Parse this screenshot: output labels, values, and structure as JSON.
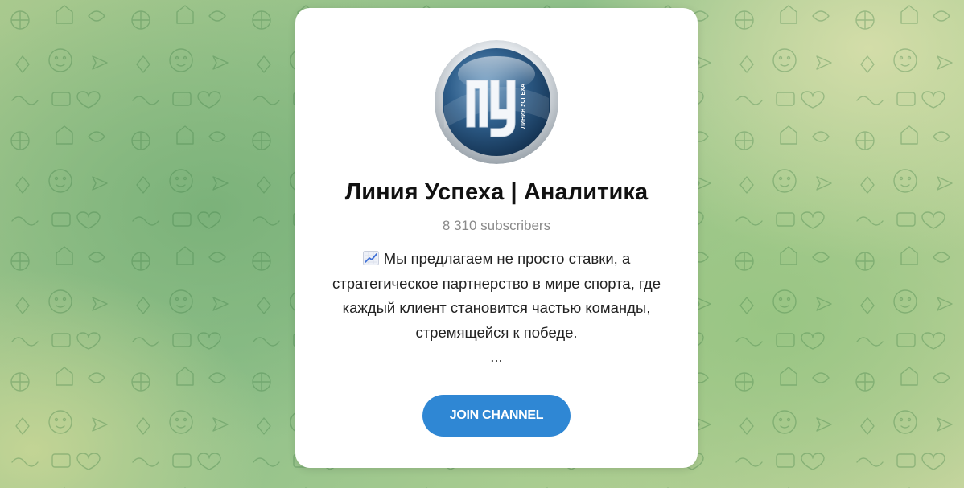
{
  "channel": {
    "title": "Линия Успеха | Аналитика",
    "subscribers": "8 310 subscribers",
    "avatar_text": "ЛУ",
    "avatar_subtext": "ЛИНИЯ УСПЕХА",
    "description": {
      "emoji": "chart-increasing-icon",
      "lines": [
        "Мы предлагаем не просто ставки, а",
        "стратегическое партнерство в мире спорта, где",
        "каждый клиент становится частью команды,",
        "стремящейся к победе."
      ],
      "ellipsis": "..."
    }
  },
  "actions": {
    "join_label": "JOIN CHANNEL"
  },
  "colors": {
    "accent": "#2f87d4",
    "title": "#111111",
    "muted": "#8a8a8a",
    "card": "#ffffff",
    "background": "#9dc48c"
  }
}
